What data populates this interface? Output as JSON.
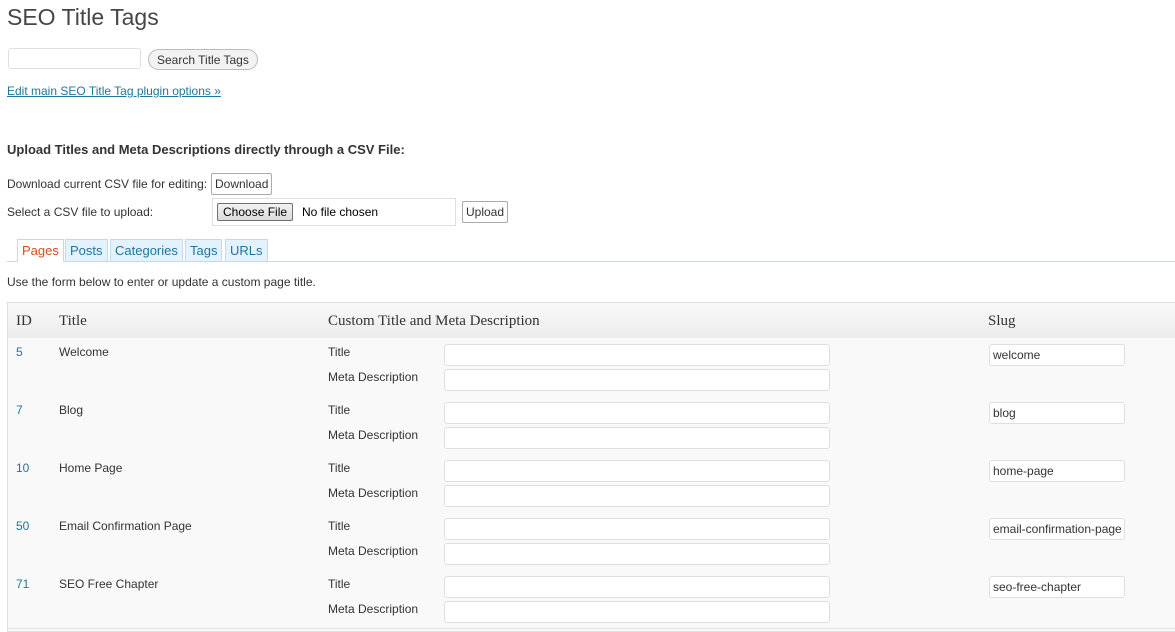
{
  "page": {
    "title": "SEO Title Tags",
    "search_button": "Search Title Tags",
    "search_value": "",
    "options_link": "Edit main SEO Title Tag plugin options »"
  },
  "csv": {
    "heading": "Upload Titles and Meta Descriptions directly through a CSV File:",
    "download_label": "Download current CSV file for editing:",
    "download_button": "Download",
    "upload_label": "Select a CSV file to upload:",
    "choose_file_button": "Choose File",
    "no_file_text": "No file chosen",
    "upload_button": "Upload"
  },
  "tabs": [
    "Pages",
    "Posts",
    "Categories",
    "Tags",
    "URLs"
  ],
  "active_tab": "Pages",
  "intro_text": "Use the form below to enter or update a custom page title.",
  "table": {
    "headers": {
      "id": "ID",
      "title": "Title",
      "custom": "Custom Title and Meta Description",
      "slug": "Slug"
    },
    "field_labels": {
      "title": "Title",
      "meta": "Meta Description"
    },
    "rows": [
      {
        "id": "5",
        "title": "Welcome",
        "custom_title": "",
        "meta_description": "",
        "slug": "welcome"
      },
      {
        "id": "7",
        "title": "Blog",
        "custom_title": "",
        "meta_description": "",
        "slug": "blog"
      },
      {
        "id": "10",
        "title": "Home Page",
        "custom_title": "",
        "meta_description": "",
        "slug": "home-page"
      },
      {
        "id": "50",
        "title": "Email Confirmation Page",
        "custom_title": "",
        "meta_description": "",
        "slug": "email-confirmation-page"
      },
      {
        "id": "71",
        "title": "SEO Free Chapter",
        "custom_title": "",
        "meta_description": "",
        "slug": "seo-free-chapter"
      }
    ]
  },
  "colors": {
    "link": "#21759b",
    "active_tab": "#d54e21",
    "tab_bg": "#e4f2fd",
    "table_bg": "#f9f9f9"
  }
}
